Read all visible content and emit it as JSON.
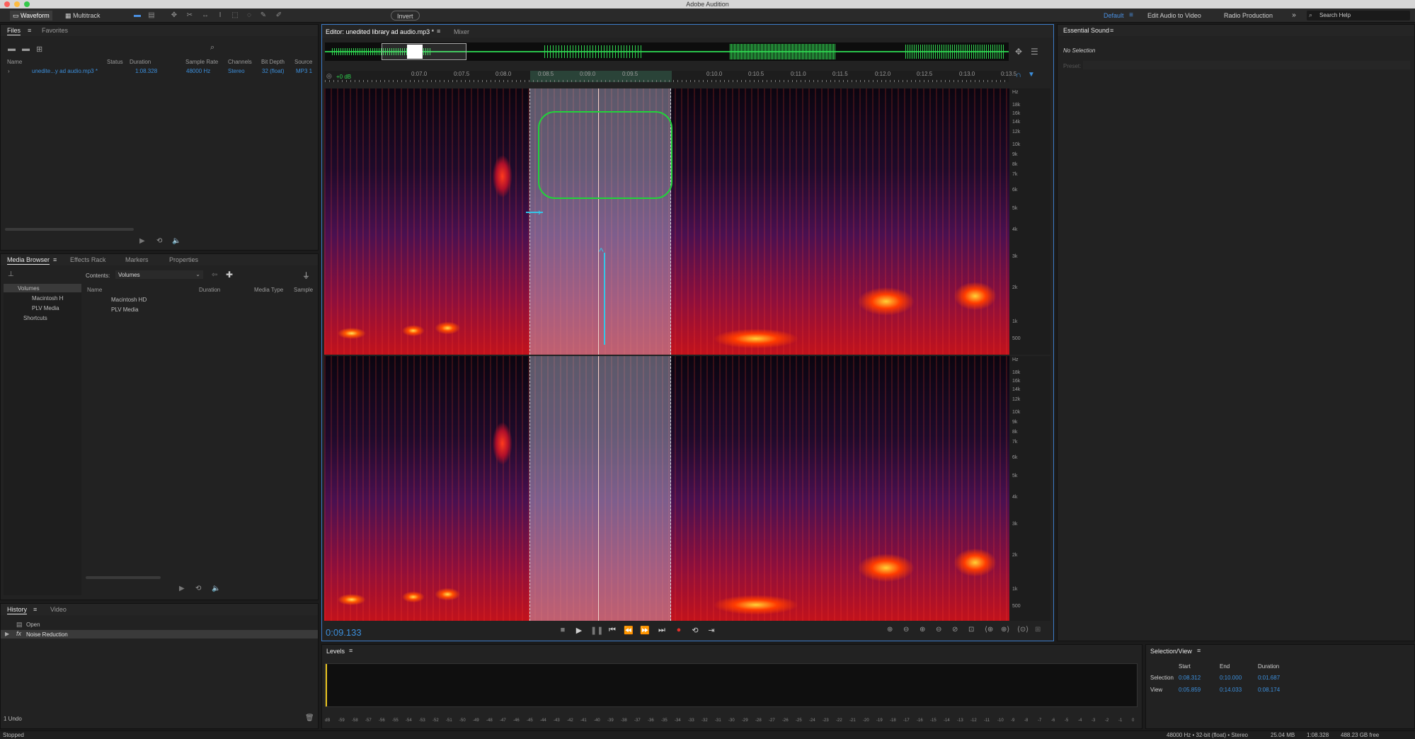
{
  "app": {
    "title": "Adobe Audition"
  },
  "toolbar": {
    "waveform": "Waveform",
    "multitrack": "Multitrack",
    "invert": "Invert",
    "workspaces": [
      "Default",
      "Edit Audio to Video",
      "Radio Production"
    ],
    "search_placeholder": "Search Help"
  },
  "files_panel": {
    "tabs": [
      "Files",
      "Favorites"
    ],
    "columns": [
      "Name",
      "Status",
      "Duration",
      "Sample Rate",
      "Channels",
      "Bit Depth",
      "Source"
    ],
    "row": {
      "name": "unedite...y ad audio.mp3 *",
      "duration": "1:08.328",
      "sample_rate": "48000 Hz",
      "channels": "Stereo",
      "bit_depth": "32 (float)",
      "source": "MP3 1"
    }
  },
  "media_panel": {
    "tabs": [
      "Media Browser",
      "Effects Rack",
      "Markers",
      "Properties"
    ],
    "contents_label": "Contents:",
    "contents_value": "Volumes",
    "tree": [
      "Volumes",
      "Macintosh H",
      "PLV Media",
      "Shortcuts"
    ],
    "columns": [
      "Name",
      "Duration",
      "Media Type",
      "Sample"
    ],
    "items": [
      "Macintosh HD",
      "PLV Media"
    ]
  },
  "history_panel": {
    "tabs": [
      "History",
      "Video"
    ],
    "items": [
      "Open",
      "Noise Reduction"
    ],
    "undo": "1 Undo"
  },
  "status": {
    "left": "Stopped",
    "right": [
      "48000 Hz • 32-bit (float) • Stereo",
      "25.04 MB",
      "1:08.328",
      "488.23 GB free"
    ]
  },
  "editor": {
    "tab": "Editor: unedited library ad audio.mp3 *",
    "mixer": "Mixer",
    "db": "+0 dB",
    "time": "0:09.133",
    "ruler": [
      "0:07.0",
      "0:07.5",
      "0:08.0",
      "0:08.5",
      "0:09.0",
      "0:09.5",
      "0:10.0",
      "0:10.5",
      "0:11.0",
      "0:11.5",
      "0:12.0",
      "0:12.5",
      "0:13.0",
      "0:13.5",
      "0:14"
    ],
    "hz": [
      "Hz",
      "18k",
      "16k",
      "14k",
      "12k",
      "10k",
      "9k",
      "8k",
      "7k",
      "6k",
      "5k",
      "4k",
      "3k",
      "2k",
      "1k",
      "500"
    ]
  },
  "essential_sound": {
    "title": "Essential Sound",
    "no_selection": "No Selection",
    "preset": "Preset:"
  },
  "levels": {
    "title": "Levels",
    "scale": [
      "dB",
      "-59",
      "-58",
      "-57",
      "-56",
      "-55",
      "-54",
      "-53",
      "-52",
      "-51",
      "-50",
      "-49",
      "-48",
      "-47",
      "-46",
      "-45",
      "-44",
      "-43",
      "-42",
      "-41",
      "-40",
      "-39",
      "-38",
      "-37",
      "-36",
      "-35",
      "-34",
      "-33",
      "-32",
      "-31",
      "-30",
      "-29",
      "-28",
      "-27",
      "-26",
      "-25",
      "-24",
      "-23",
      "-22",
      "-21",
      "-20",
      "-19",
      "-18",
      "-17",
      "-16",
      "-15",
      "-14",
      "-13",
      "-12",
      "-11",
      "-10",
      "-9",
      "-8",
      "-7",
      "-6",
      "-5",
      "-4",
      "-3",
      "-2",
      "-1",
      "0"
    ]
  },
  "selection_view": {
    "title": "Selection/View",
    "cols": [
      "Start",
      "End",
      "Duration"
    ],
    "selection": {
      "label": "Selection",
      "start": "0:08.312",
      "end": "0:10.000",
      "duration": "0:01.687"
    },
    "view": {
      "label": "View",
      "start": "0:05.859",
      "end": "0:14.033",
      "duration": "0:08.174"
    }
  }
}
